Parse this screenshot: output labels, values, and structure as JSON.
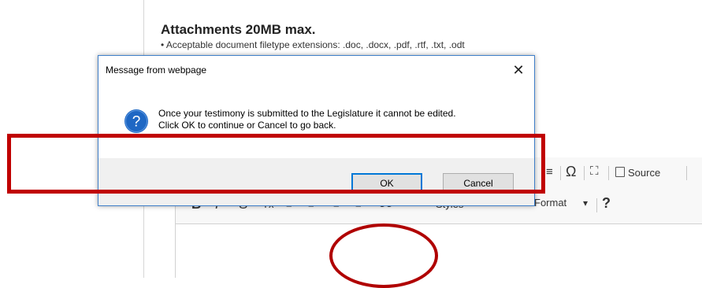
{
  "page": {
    "attachments_title": "Attachments 20MB max.",
    "attachments_note": "• Acceptable document filetype extensions: .doc, .docx, .pdf, .rtf, .txt, .odt"
  },
  "editor": {
    "toolbar": {
      "omega": "Ω",
      "maximize": "⛶",
      "source_label": "Source",
      "bold": "B",
      "italic": "I",
      "strike": "S",
      "remove_format": "Tx",
      "styles_label": "Styles",
      "format_label": "Format",
      "dropdown_caret": "▾",
      "help": "?",
      "quote": "99"
    }
  },
  "dialog": {
    "title": "Message from webpage",
    "close_symbol": "✕",
    "message_line1": "Once your testimony is submitted to the Legislature it cannot be edited.",
    "message_line2": "Click OK to continue or Cancel to go back.",
    "ok_label": "OK",
    "cancel_label": "Cancel",
    "icon": "question-icon",
    "icon_color": "#1e67c4"
  },
  "annotations": {
    "color": "#c00000"
  }
}
